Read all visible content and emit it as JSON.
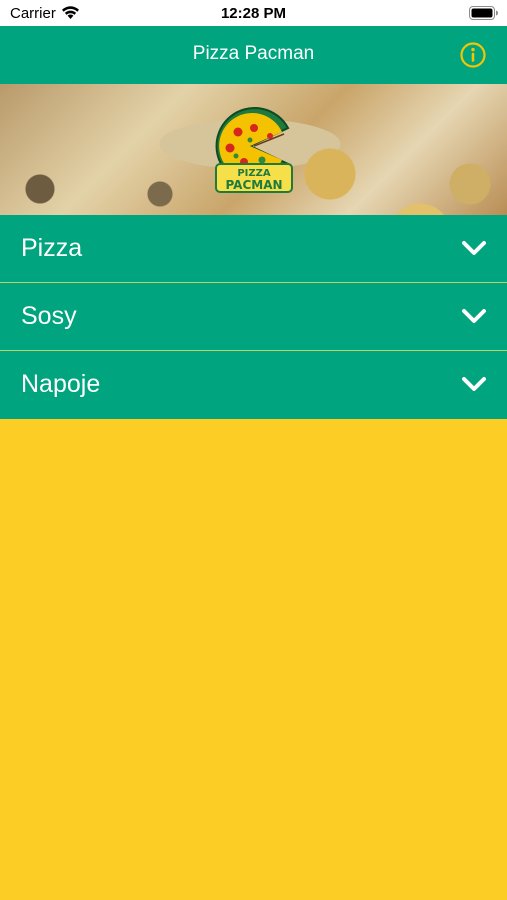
{
  "status_bar": {
    "carrier": "Carrier",
    "time": "12:28 PM",
    "wifi_icon": "wifi-icon",
    "battery_icon": "battery-icon"
  },
  "nav": {
    "title": "Pizza Pacman",
    "info_icon": "info-circle-icon"
  },
  "banner": {
    "logo_text_line1": "PIZZA",
    "logo_text_line2": "PACMAN"
  },
  "menu": {
    "items": [
      {
        "label": "Pizza",
        "icon": "chevron-down-icon"
      },
      {
        "label": "Sosy",
        "icon": "chevron-down-icon"
      },
      {
        "label": "Napoje",
        "icon": "chevron-down-icon"
      }
    ]
  },
  "colors": {
    "primary_green": "#00A47E",
    "background_yellow": "#FCCD24",
    "accent_yellow": "#F6C400",
    "row_separator": "#B6D86A",
    "text_white": "#FFFFFF"
  }
}
